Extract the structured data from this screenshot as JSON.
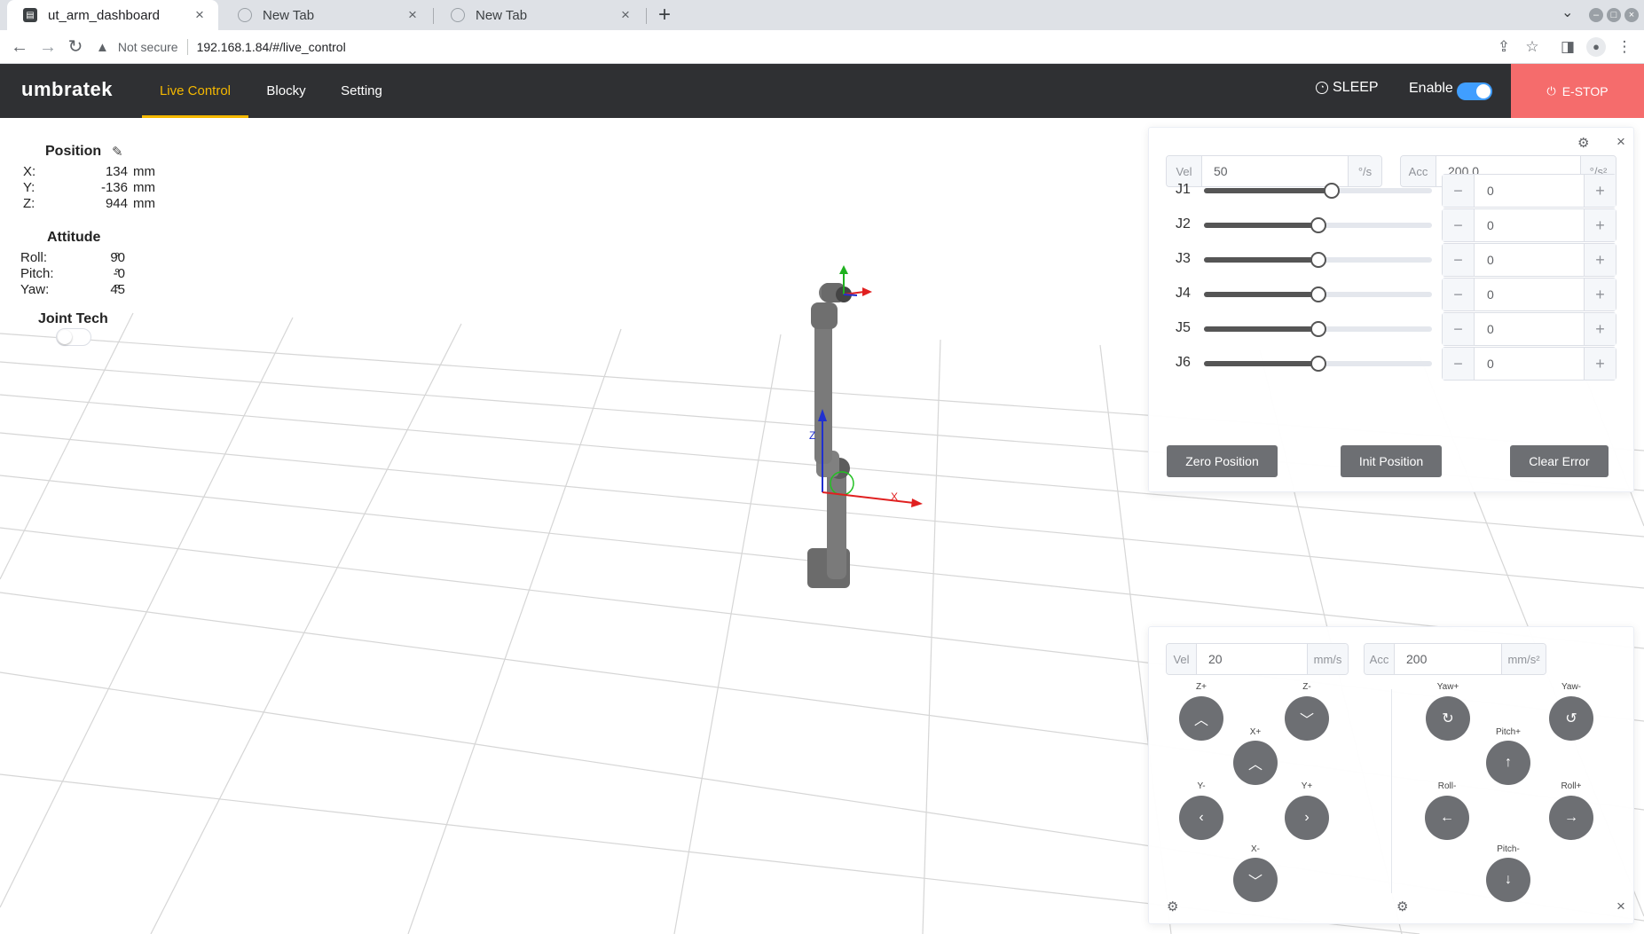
{
  "browser": {
    "tabs": [
      {
        "title": "ut_arm_dashboard",
        "active": true
      },
      {
        "title": "New Tab",
        "active": false
      },
      {
        "title": "New Tab",
        "active": false
      }
    ],
    "security_label": "Not secure",
    "url": "192.168.1.84/#/live_control"
  },
  "app": {
    "logo": "umbratek",
    "nav": [
      {
        "label": "Live Control",
        "active": true
      },
      {
        "label": "Blocky",
        "active": false
      },
      {
        "label": "Setting",
        "active": false
      }
    ],
    "sleep_label": "SLEEP",
    "enable_label": "Enable",
    "enable_on": true,
    "estop_label": "E-STOP",
    "accent_color": "#f5b800",
    "estop_color": "#f56c6c",
    "toggle_color": "#409eff"
  },
  "info": {
    "position_title": "Position",
    "position": [
      {
        "key": "X:",
        "value": "134",
        "unit": "mm"
      },
      {
        "key": "Y:",
        "value": "-136",
        "unit": "mm"
      },
      {
        "key": "Z:",
        "value": "944",
        "unit": "mm"
      }
    ],
    "attitude_title": "Attitude",
    "attitude": [
      {
        "key": "Roll:",
        "value": "90",
        "unit": "°"
      },
      {
        "key": "Pitch:",
        "value": "-0",
        "unit": "°"
      },
      {
        "key": "Yaw:",
        "value": "45",
        "unit": "°"
      }
    ],
    "joint_tech_title": "Joint Tech",
    "joint_tech_on": false
  },
  "joint_panel": {
    "vel_prefix": "Vel",
    "vel_value": "50",
    "vel_unit": "°/s",
    "acc_prefix": "Acc",
    "acc_value": "200.0",
    "acc_unit": "°/s²",
    "joints": [
      {
        "label": "J1",
        "value": "0",
        "slider_fraction": 0.56
      },
      {
        "label": "J2",
        "value": "0",
        "slider_fraction": 0.5
      },
      {
        "label": "J3",
        "value": "0",
        "slider_fraction": 0.5
      },
      {
        "label": "J4",
        "value": "0",
        "slider_fraction": 0.5
      },
      {
        "label": "J5",
        "value": "0",
        "slider_fraction": 0.5
      },
      {
        "label": "J6",
        "value": "0",
        "slider_fraction": 0.5
      }
    ],
    "buttons": {
      "zero": "Zero Position",
      "init": "Init Position",
      "clear": "Clear Error"
    }
  },
  "cartesian_panel": {
    "vel_prefix": "Vel",
    "vel_value": "20",
    "vel_unit": "mm/s",
    "acc_prefix": "Acc",
    "acc_value": "200",
    "acc_unit": "mm/s²",
    "labels": {
      "zp": "Z+",
      "zm": "Z-",
      "xp": "X+",
      "ym": "Y-",
      "yp": "Y+",
      "xm": "X-",
      "yawp": "Yaw+",
      "yawm": "Yaw-",
      "pitchp": "Pitch+",
      "rollm": "Roll-",
      "rollp": "Roll+",
      "pitchm": "Pitch-"
    }
  },
  "scene": {
    "axis_label_z": "Z",
    "axis_label_x": "X"
  }
}
